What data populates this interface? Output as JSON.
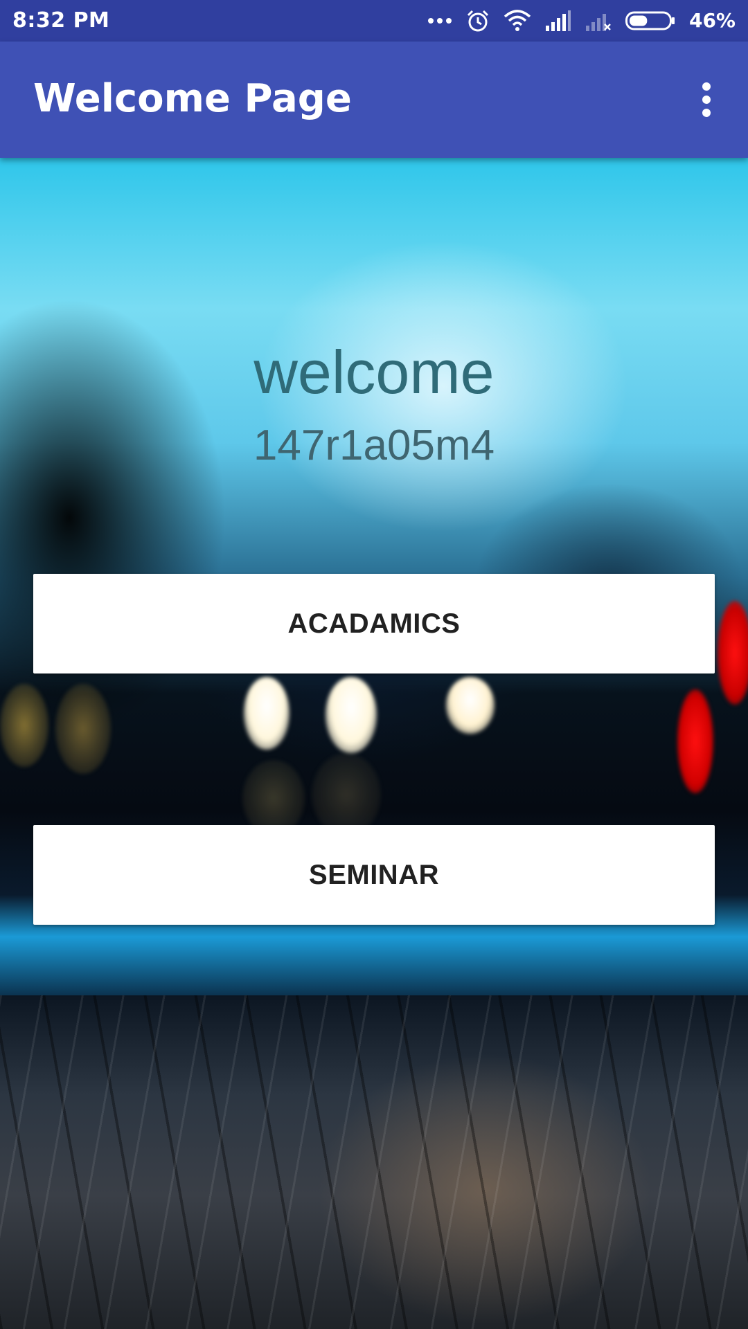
{
  "status_bar": {
    "time": "8:32 PM",
    "battery_percent": "46%",
    "battery_level": 0.46,
    "icons": [
      "more-dots-icon",
      "alarm-icon",
      "wifi-icon",
      "cell-signal-icon",
      "no-signal-icon",
      "battery-icon"
    ]
  },
  "app_bar": {
    "title": "Welcome Page",
    "menu_icon": "overflow-menu-icon"
  },
  "main": {
    "welcome_text": "welcome",
    "user_id": "147r1a05m4",
    "buttons": {
      "academics": "ACADAMICS",
      "seminar": "SEMINAR"
    }
  },
  "colors": {
    "status_bar": "#303F9F",
    "app_bar": "#3F51B5",
    "button_bg": "#FFFFFF",
    "button_text": "#212121",
    "welcome_text": "#2F6B78"
  }
}
